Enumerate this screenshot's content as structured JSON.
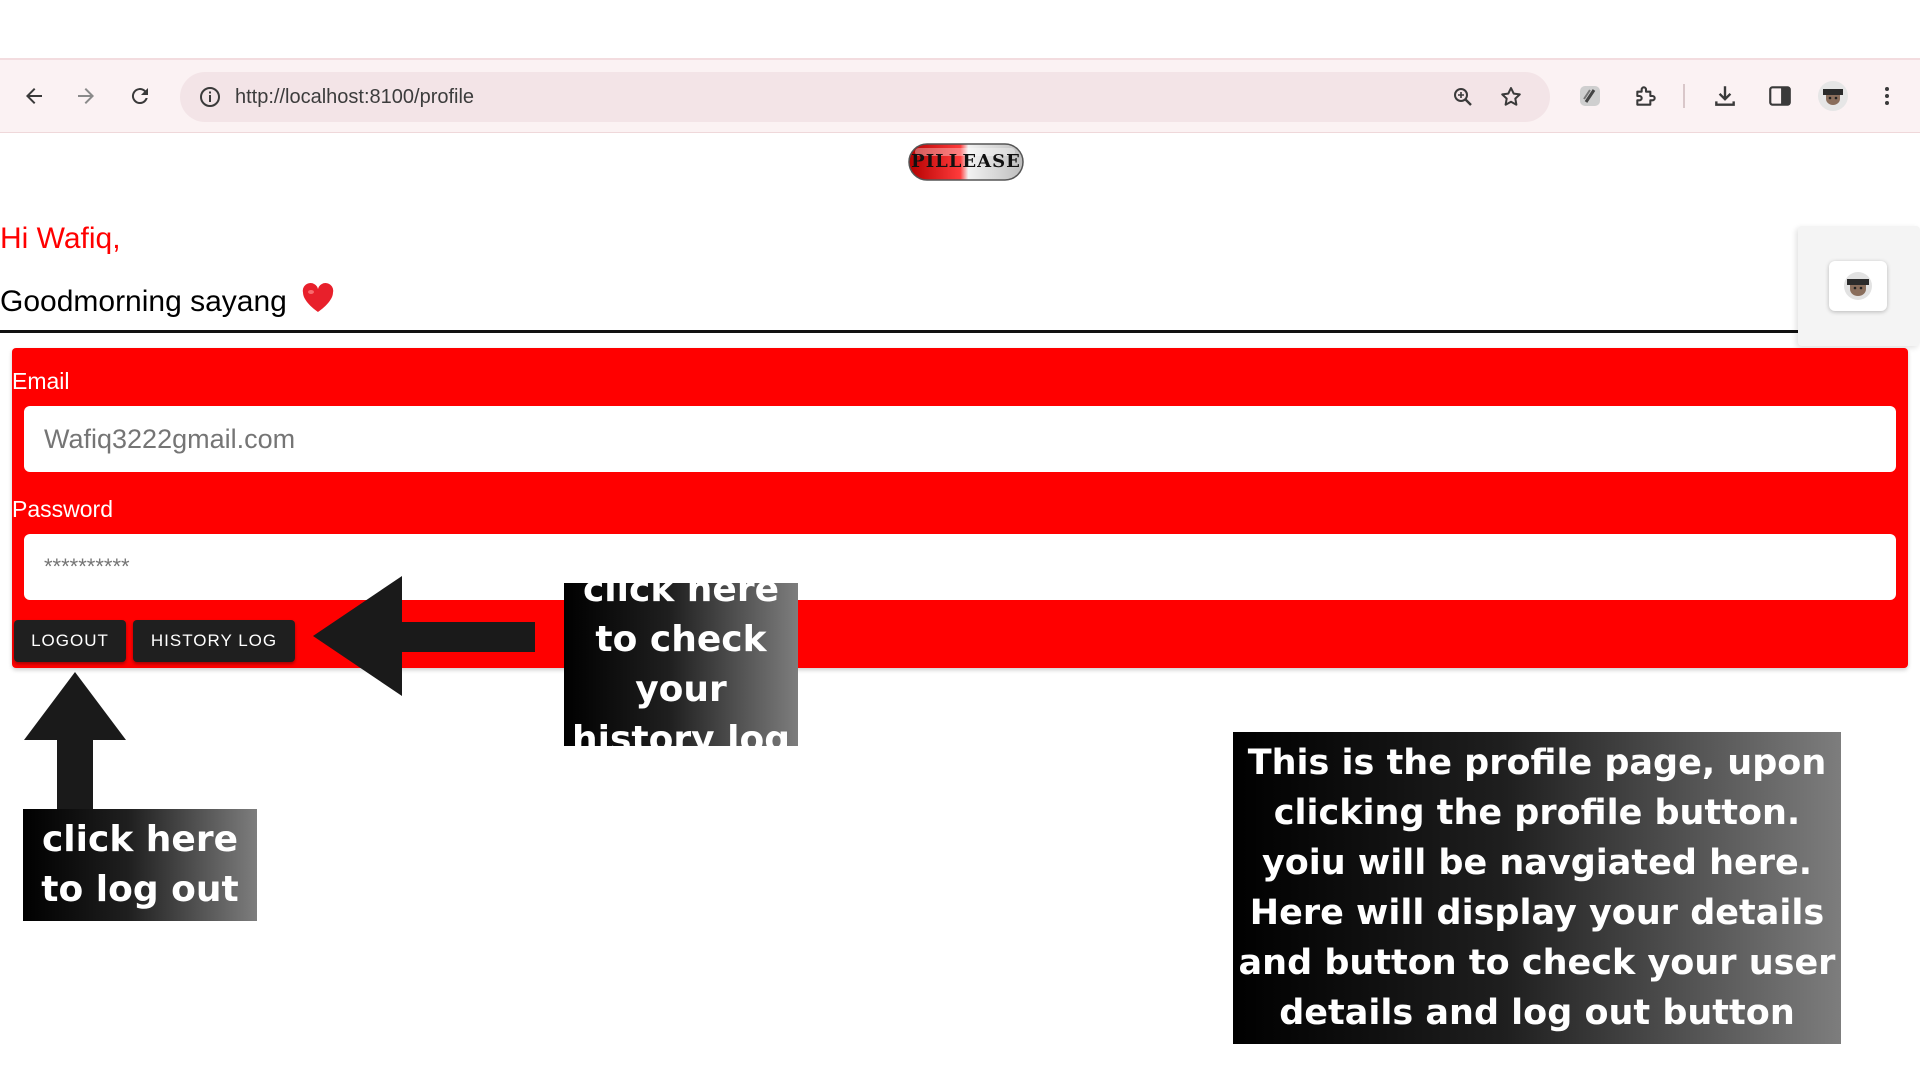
{
  "browser": {
    "url": "http://localhost:8100/profile",
    "icons": [
      "back-arrow-icon",
      "forward-arrow-icon",
      "reload-icon",
      "site-info-icon",
      "zoom-icon",
      "bookmark-star-icon",
      "extension-icon",
      "puzzle-extensions-icon",
      "download-icon",
      "side-panel-icon",
      "profile-avatar-icon",
      "more-menu-icon"
    ]
  },
  "header": {
    "logo_text": "PILLEASE"
  },
  "greeting": {
    "line1": "Hi Wafiq,",
    "line2": "Goodmorning sayang",
    "emoji": "❤️"
  },
  "form": {
    "email_label": "Email",
    "email_value": "Wafiq3222gmail.com",
    "password_label": "Password",
    "password_value": "**********",
    "logout_label": "LOGOUT",
    "history_label": "HISTORY LOG"
  },
  "annotations": {
    "history": "click here to check your history log",
    "logout": "click here to log out",
    "description": "This is the profile page, upon clicking the profile button. yoiu will be navgiated here. Here will display your details and button to check your user details and log out button"
  },
  "colors": {
    "panel": "#ff0000",
    "greeting_name": "#ff0000",
    "button": "#1f1f1f",
    "chrome_bg": "#fbf2f3"
  }
}
